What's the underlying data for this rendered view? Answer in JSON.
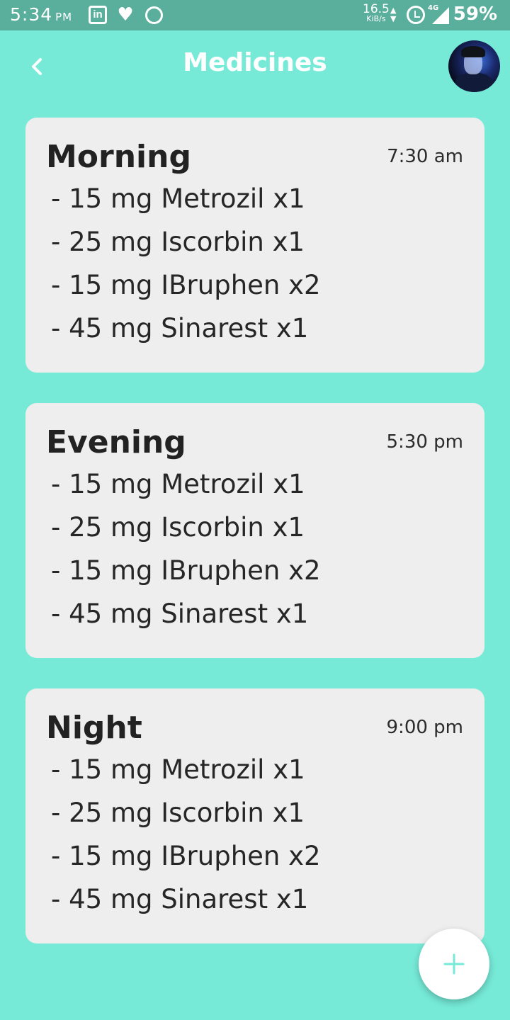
{
  "status_bar": {
    "time": "5:34",
    "ampm": "PM",
    "net_speed": "16.5",
    "net_unit": "KiB/s",
    "network": "4G",
    "battery": "59%",
    "icons": [
      "linkedin-icon",
      "heart-icon",
      "circle-app-icon",
      "alarm-icon",
      "signal-icon"
    ]
  },
  "header": {
    "title": "Medicines",
    "back_icon": "chevron-left-icon",
    "avatar_icon": "user-avatar"
  },
  "schedule": [
    {
      "period": "Morning",
      "time": "7:30 am",
      "medicines": [
        "- 15 mg Metrozil x1",
        "- 25 mg Iscorbin x1",
        "- 15 mg IBruphen x2",
        "- 45 mg Sinarest x1"
      ]
    },
    {
      "period": "Evening",
      "time": "5:30 pm",
      "medicines": [
        "- 15 mg Metrozil x1",
        "- 25 mg Iscorbin x1",
        "- 15 mg IBruphen x2",
        "- 45 mg Sinarest x1"
      ]
    },
    {
      "period": "Night",
      "time": "9:00 pm",
      "medicines": [
        "- 15 mg Metrozil x1",
        "- 25 mg Iscorbin x1",
        "- 15 mg IBruphen x2",
        "- 45 mg Sinarest x1"
      ]
    }
  ],
  "fab": {
    "icon": "plus-icon"
  },
  "colors": {
    "background": "#76EAD7",
    "status_bar": "#5AAE9C",
    "card": "#EEEEEE",
    "accent": "#76EAD7"
  }
}
